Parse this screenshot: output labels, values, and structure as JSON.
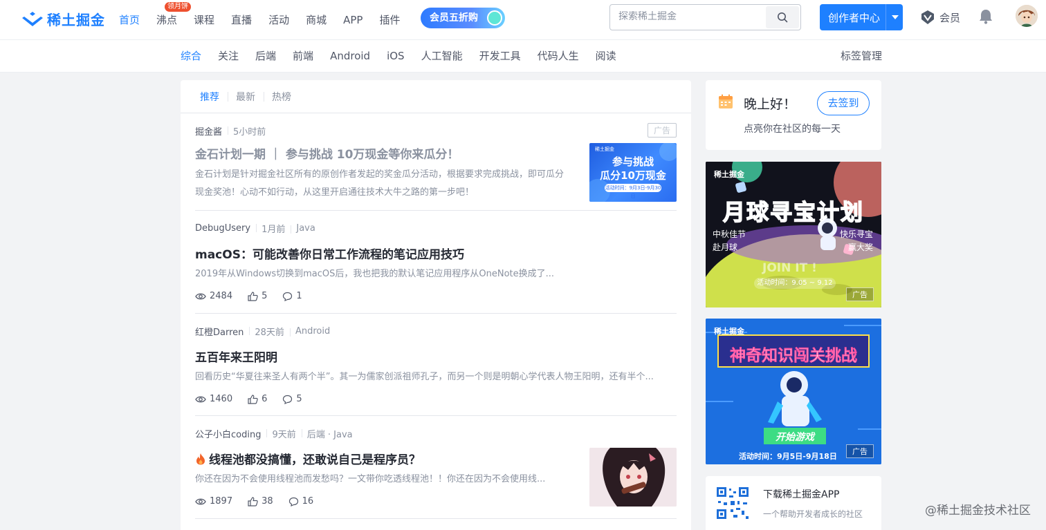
{
  "header": {
    "logo_text": "稀土掘金",
    "nav": [
      {
        "label": "首页",
        "active": true
      },
      {
        "label": "沸点",
        "badge": "领月饼"
      },
      {
        "label": "课程"
      },
      {
        "label": "直播"
      },
      {
        "label": "活动"
      },
      {
        "label": "商城"
      },
      {
        "label": "APP"
      },
      {
        "label": "插件"
      }
    ],
    "vip_promo": "会员五折购",
    "search_placeholder": "探索稀土掘金",
    "creator_label": "创作者中心",
    "member_label": "会员"
  },
  "tagbar": {
    "tags": [
      "综合",
      "关注",
      "后端",
      "前端",
      "Android",
      "iOS",
      "人工智能",
      "开发工具",
      "代码人生",
      "阅读"
    ],
    "active": "综合",
    "manage": "标签管理"
  },
  "feed": {
    "tabs": [
      "推荐",
      "最新",
      "热榜"
    ],
    "items": [
      {
        "author": "掘金酱",
        "time": "5小时前",
        "ad": "广告",
        "title": "金石计划一期 ｜ 参与挑战 10万现金等你来瓜分！",
        "desc": "金石计划是针对掘金社区所有的原创作者发起的奖金瓜分活动，根据要求完成挑战，即可瓜分现金奖池！心动不如行动，从这里开启通往技术大牛之路的第一步吧！",
        "thumb_line1": "参与挑战",
        "thumb_line2": "瓜分10万现金",
        "thumb_line3": "活动时间：9月3日-9月30日",
        "thumb_brand": "稀土掘金"
      },
      {
        "author": "DebugUsery",
        "time": "1月前",
        "tags": "Java",
        "title": "macOS：可能改善你日常工作流程的笔记应用技巧",
        "desc": "2019年从Windows切换到macOS后，我也把我的默认笔记应用程序从OneNote换成了...",
        "views": "2484",
        "likes": "5",
        "comments": "1"
      },
      {
        "author": "红橙Darren",
        "time": "28天前",
        "tags": "Android",
        "title": "五百年来王阳明",
        "desc": "回看历史“华夏往来圣人有两个半”。其一为儒家创派祖师孔子，而另一个则是明朝心学代表人物王阳明，还有半个...",
        "views": "1460",
        "likes": "6",
        "comments": "5"
      },
      {
        "author": "公子小白coding",
        "time": "9天前",
        "tags": "后端 · Java",
        "title": "线程池都没搞懂，还敢说自己是程序员？",
        "desc": "你还在因为不会使用线程池而发愁吗？一文带你吃透线程池！！你还在因为不会使用线...",
        "views": "1897",
        "likes": "38",
        "comments": "16"
      }
    ]
  },
  "sidebar": {
    "greeting": "晚上好！",
    "greeting_sub": "点亮你在社区的每一天",
    "signin_button": "去签到",
    "banner1": {
      "brand": "稀土掘金",
      "title": "月球寻宝计划",
      "left_line1": "中秋佳节",
      "left_line2": "赴月球",
      "right_line1": "快乐寻宝",
      "right_line2": "赢大奖",
      "join": "JOIN IT !",
      "time": "活动时间：9.05 ~ 9.12",
      "ad": "广告"
    },
    "banner2": {
      "brand": "稀土掘金",
      "title": "神奇知识闯关挑战",
      "start": "开始游戏",
      "time": "活动时间：9月5日-9月18日",
      "ad": "广告"
    },
    "app_title": "下载稀土掘金APP",
    "app_sub": "一个帮助开发者成长的社区"
  },
  "watermark": "@稀土掘金技术社区",
  "colors": {
    "brand": "#1e80ff",
    "text": "#252933",
    "muted": "#8a919f",
    "badge": "#ee502f"
  }
}
